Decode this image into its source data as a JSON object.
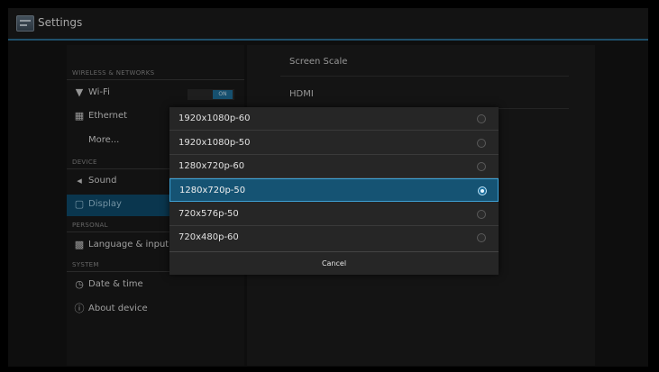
{
  "actionbar": {
    "title": "Settings",
    "icon": "settings-app-icon"
  },
  "sidebar": {
    "sections": {
      "wireless": "WIRELESS & NETWORKS",
      "device": "DEVICE",
      "personal": "PERSONAL",
      "system": "SYSTEM"
    },
    "items": [
      {
        "label": "Wi-Fi",
        "icon": "wifi-icon",
        "toggle": "ON"
      },
      {
        "label": "Ethernet",
        "icon": "ethernet-icon"
      },
      {
        "label": "More..."
      },
      {
        "label": "Sound",
        "icon": "sound-icon"
      },
      {
        "label": "Display",
        "icon": "display-icon",
        "active": true
      },
      {
        "label": "Language & input",
        "icon": "keyboard-icon"
      },
      {
        "label": "Date & time",
        "icon": "clock-icon"
      },
      {
        "label": "About device",
        "icon": "info-icon"
      }
    ]
  },
  "main": {
    "items": [
      {
        "label": "Screen Scale"
      },
      {
        "label": "HDMI"
      }
    ]
  },
  "dialog": {
    "options": [
      {
        "label": "1920x1080p-60",
        "selected": false
      },
      {
        "label": "1920x1080p-50",
        "selected": false
      },
      {
        "label": "1280x720p-60",
        "selected": false
      },
      {
        "label": "1280x720p-50",
        "selected": true
      },
      {
        "label": "720x576p-50",
        "selected": false
      },
      {
        "label": "720x480p-60",
        "selected": false
      }
    ],
    "cancel_label": "Cancel"
  },
  "colors": {
    "accent": "#2c6f95",
    "selected_bg": "#155373",
    "selected_border": "#3ea2d6"
  }
}
